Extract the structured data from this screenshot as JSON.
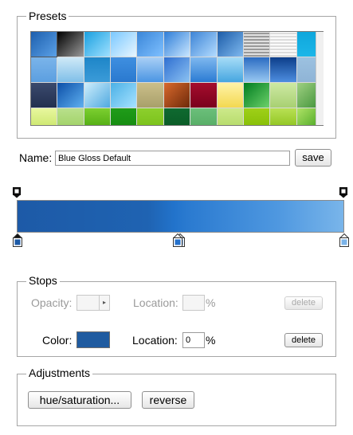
{
  "presets": {
    "legend": "Presets",
    "swatches": [
      "linear-gradient(135deg,#1d5fae,#5aa0e6)",
      "linear-gradient(135deg,#000,#9a9a9a)",
      "linear-gradient(135deg,#1aa0e0,#9fe0ff)",
      "linear-gradient(135deg,#7ac8ff,#e8f6ff)",
      "linear-gradient(135deg,#3a86d8,#7fc0ff)",
      "linear-gradient(135deg,#2f7ed8,#c8e6ff)",
      "linear-gradient(135deg,#3d84d6,#b3dcff)",
      "linear-gradient(135deg,#1c5ca8,#7fb9ef)",
      "repeating-linear-gradient(0deg,#9a9a9a 0 2px,#e0e0e0 2px 4px)",
      "repeating-linear-gradient(0deg,#dcdcdc 0 2px,#fafafa 2px 4px)",
      "linear-gradient(180deg,#0fa7dc,#1cb6e8)",
      "linear-gradient(180deg,#7ab4ea,#5c9fe0)",
      "linear-gradient(180deg,#cfe9f7,#7fbfe8)",
      "linear-gradient(180deg,#1e86c8,#3b9bd8)",
      "linear-gradient(180deg,#3f8fe0,#2a79cf)",
      "linear-gradient(180deg,#a9cff5,#4a95e3)",
      "linear-gradient(135deg,#2f6fd1,#8cc2f2)",
      "linear-gradient(180deg,#7eb8ef,#2b7bd3)",
      "linear-gradient(180deg,#a6dcf7,#46a6e0)",
      "linear-gradient(180deg,#2b6cc2,#99c9f2)",
      "linear-gradient(180deg,#0d3e8a,#4d8ee0)",
      "linear-gradient(180deg,#9cc1e0,#8fb4d6)",
      "linear-gradient(180deg,#3b4a6e,#222f4f)",
      "linear-gradient(135deg,#0c4fa8,#5fb0f0)",
      "linear-gradient(135deg,#cfeefc,#4fa9e0)",
      "linear-gradient(135deg,#4bb0e6,#a6e2ff)",
      "linear-gradient(180deg,#cbbf8a,#a8a06a)",
      "linear-gradient(135deg,#d9692c,#6e2a0a)",
      "linear-gradient(180deg,#a50d2d,#7a001c)",
      "linear-gradient(180deg,#fff3a8,#f3d850)",
      "linear-gradient(135deg,#007c20,#6cd16a)",
      "linear-gradient(180deg,#cde9a3,#a8d072)",
      "linear-gradient(135deg,#9fd081,#3b8f35)",
      "linear-gradient(180deg,#e8f79e,#c9e56a)",
      "linear-gradient(180deg,#b9e08c,#9fd064)",
      "linear-gradient(180deg,#7ccf30,#4ea910)",
      "linear-gradient(180deg,#1f9c19,#158a10)",
      "linear-gradient(180deg,#8dcf2d,#78c018)",
      "linear-gradient(180deg,#0f6a30,#0a5a26)",
      "linear-gradient(180deg,#6bbf7a,#55ab64)",
      "linear-gradient(180deg,#cde98a,#b3d967)",
      "linear-gradient(180deg,#9fd018,#85bd05)",
      "linear-gradient(180deg,#b8e054,#8cc21b)",
      "linear-gradient(135deg,#aee265,#3f9f1c)"
    ]
  },
  "name_field": {
    "label": "Name:",
    "value": "Blue Gloss Default",
    "save_label": "save"
  },
  "gradient": {
    "css": "linear-gradient(90deg,#1d5aa7 0%,#1f63b2 40%,#2273cb 48%,#2a7ad0 52%,#4f98e0 80%,#79b5ea 100%)",
    "color_stop_colors": [
      "#1d5aa7",
      "#2672cc",
      "#7ab3e8"
    ],
    "color_stop_locations": [
      0,
      49,
      100
    ],
    "opacity_stop_locations": [
      0,
      100
    ]
  },
  "stops": {
    "legend": "Stops",
    "opacity_label": "Opacity:",
    "opacity_location_label": "Location:",
    "opacity_location_value": "",
    "percent": "%",
    "delete_label": "delete",
    "color_label": "Color:",
    "color_value": "#1f5ba0",
    "color_location_label": "Location:",
    "color_location_value": "0"
  },
  "adjustments": {
    "legend": "Adjustments",
    "hue_saturation_label": "hue/saturation...",
    "reverse_label": "reverse"
  }
}
